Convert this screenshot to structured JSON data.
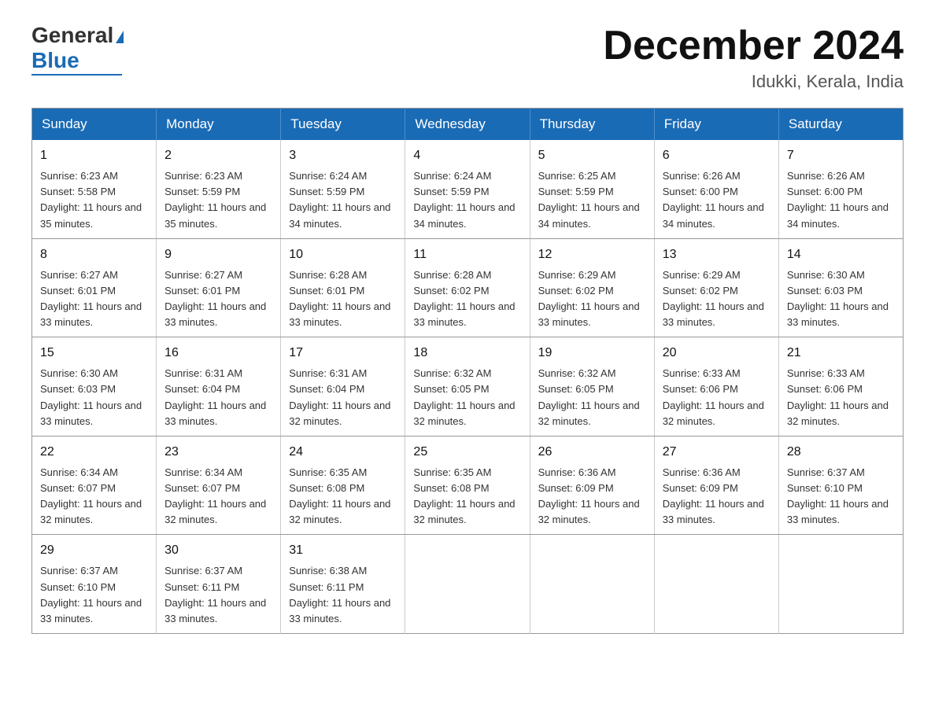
{
  "logo": {
    "general": "General",
    "blue": "Blue"
  },
  "title": "December 2024",
  "subtitle": "Idukki, Kerala, India",
  "weekdays": [
    "Sunday",
    "Monday",
    "Tuesday",
    "Wednesday",
    "Thursday",
    "Friday",
    "Saturday"
  ],
  "weeks": [
    [
      {
        "day": "1",
        "sunrise": "Sunrise: 6:23 AM",
        "sunset": "Sunset: 5:58 PM",
        "daylight": "Daylight: 11 hours and 35 minutes."
      },
      {
        "day": "2",
        "sunrise": "Sunrise: 6:23 AM",
        "sunset": "Sunset: 5:59 PM",
        "daylight": "Daylight: 11 hours and 35 minutes."
      },
      {
        "day": "3",
        "sunrise": "Sunrise: 6:24 AM",
        "sunset": "Sunset: 5:59 PM",
        "daylight": "Daylight: 11 hours and 34 minutes."
      },
      {
        "day": "4",
        "sunrise": "Sunrise: 6:24 AM",
        "sunset": "Sunset: 5:59 PM",
        "daylight": "Daylight: 11 hours and 34 minutes."
      },
      {
        "day": "5",
        "sunrise": "Sunrise: 6:25 AM",
        "sunset": "Sunset: 5:59 PM",
        "daylight": "Daylight: 11 hours and 34 minutes."
      },
      {
        "day": "6",
        "sunrise": "Sunrise: 6:26 AM",
        "sunset": "Sunset: 6:00 PM",
        "daylight": "Daylight: 11 hours and 34 minutes."
      },
      {
        "day": "7",
        "sunrise": "Sunrise: 6:26 AM",
        "sunset": "Sunset: 6:00 PM",
        "daylight": "Daylight: 11 hours and 34 minutes."
      }
    ],
    [
      {
        "day": "8",
        "sunrise": "Sunrise: 6:27 AM",
        "sunset": "Sunset: 6:01 PM",
        "daylight": "Daylight: 11 hours and 33 minutes."
      },
      {
        "day": "9",
        "sunrise": "Sunrise: 6:27 AM",
        "sunset": "Sunset: 6:01 PM",
        "daylight": "Daylight: 11 hours and 33 minutes."
      },
      {
        "day": "10",
        "sunrise": "Sunrise: 6:28 AM",
        "sunset": "Sunset: 6:01 PM",
        "daylight": "Daylight: 11 hours and 33 minutes."
      },
      {
        "day": "11",
        "sunrise": "Sunrise: 6:28 AM",
        "sunset": "Sunset: 6:02 PM",
        "daylight": "Daylight: 11 hours and 33 minutes."
      },
      {
        "day": "12",
        "sunrise": "Sunrise: 6:29 AM",
        "sunset": "Sunset: 6:02 PM",
        "daylight": "Daylight: 11 hours and 33 minutes."
      },
      {
        "day": "13",
        "sunrise": "Sunrise: 6:29 AM",
        "sunset": "Sunset: 6:02 PM",
        "daylight": "Daylight: 11 hours and 33 minutes."
      },
      {
        "day": "14",
        "sunrise": "Sunrise: 6:30 AM",
        "sunset": "Sunset: 6:03 PM",
        "daylight": "Daylight: 11 hours and 33 minutes."
      }
    ],
    [
      {
        "day": "15",
        "sunrise": "Sunrise: 6:30 AM",
        "sunset": "Sunset: 6:03 PM",
        "daylight": "Daylight: 11 hours and 33 minutes."
      },
      {
        "day": "16",
        "sunrise": "Sunrise: 6:31 AM",
        "sunset": "Sunset: 6:04 PM",
        "daylight": "Daylight: 11 hours and 33 minutes."
      },
      {
        "day": "17",
        "sunrise": "Sunrise: 6:31 AM",
        "sunset": "Sunset: 6:04 PM",
        "daylight": "Daylight: 11 hours and 32 minutes."
      },
      {
        "day": "18",
        "sunrise": "Sunrise: 6:32 AM",
        "sunset": "Sunset: 6:05 PM",
        "daylight": "Daylight: 11 hours and 32 minutes."
      },
      {
        "day": "19",
        "sunrise": "Sunrise: 6:32 AM",
        "sunset": "Sunset: 6:05 PM",
        "daylight": "Daylight: 11 hours and 32 minutes."
      },
      {
        "day": "20",
        "sunrise": "Sunrise: 6:33 AM",
        "sunset": "Sunset: 6:06 PM",
        "daylight": "Daylight: 11 hours and 32 minutes."
      },
      {
        "day": "21",
        "sunrise": "Sunrise: 6:33 AM",
        "sunset": "Sunset: 6:06 PM",
        "daylight": "Daylight: 11 hours and 32 minutes."
      }
    ],
    [
      {
        "day": "22",
        "sunrise": "Sunrise: 6:34 AM",
        "sunset": "Sunset: 6:07 PM",
        "daylight": "Daylight: 11 hours and 32 minutes."
      },
      {
        "day": "23",
        "sunrise": "Sunrise: 6:34 AM",
        "sunset": "Sunset: 6:07 PM",
        "daylight": "Daylight: 11 hours and 32 minutes."
      },
      {
        "day": "24",
        "sunrise": "Sunrise: 6:35 AM",
        "sunset": "Sunset: 6:08 PM",
        "daylight": "Daylight: 11 hours and 32 minutes."
      },
      {
        "day": "25",
        "sunrise": "Sunrise: 6:35 AM",
        "sunset": "Sunset: 6:08 PM",
        "daylight": "Daylight: 11 hours and 32 minutes."
      },
      {
        "day": "26",
        "sunrise": "Sunrise: 6:36 AM",
        "sunset": "Sunset: 6:09 PM",
        "daylight": "Daylight: 11 hours and 32 minutes."
      },
      {
        "day": "27",
        "sunrise": "Sunrise: 6:36 AM",
        "sunset": "Sunset: 6:09 PM",
        "daylight": "Daylight: 11 hours and 33 minutes."
      },
      {
        "day": "28",
        "sunrise": "Sunrise: 6:37 AM",
        "sunset": "Sunset: 6:10 PM",
        "daylight": "Daylight: 11 hours and 33 minutes."
      }
    ],
    [
      {
        "day": "29",
        "sunrise": "Sunrise: 6:37 AM",
        "sunset": "Sunset: 6:10 PM",
        "daylight": "Daylight: 11 hours and 33 minutes."
      },
      {
        "day": "30",
        "sunrise": "Sunrise: 6:37 AM",
        "sunset": "Sunset: 6:11 PM",
        "daylight": "Daylight: 11 hours and 33 minutes."
      },
      {
        "day": "31",
        "sunrise": "Sunrise: 6:38 AM",
        "sunset": "Sunset: 6:11 PM",
        "daylight": "Daylight: 11 hours and 33 minutes."
      },
      null,
      null,
      null,
      null
    ]
  ]
}
